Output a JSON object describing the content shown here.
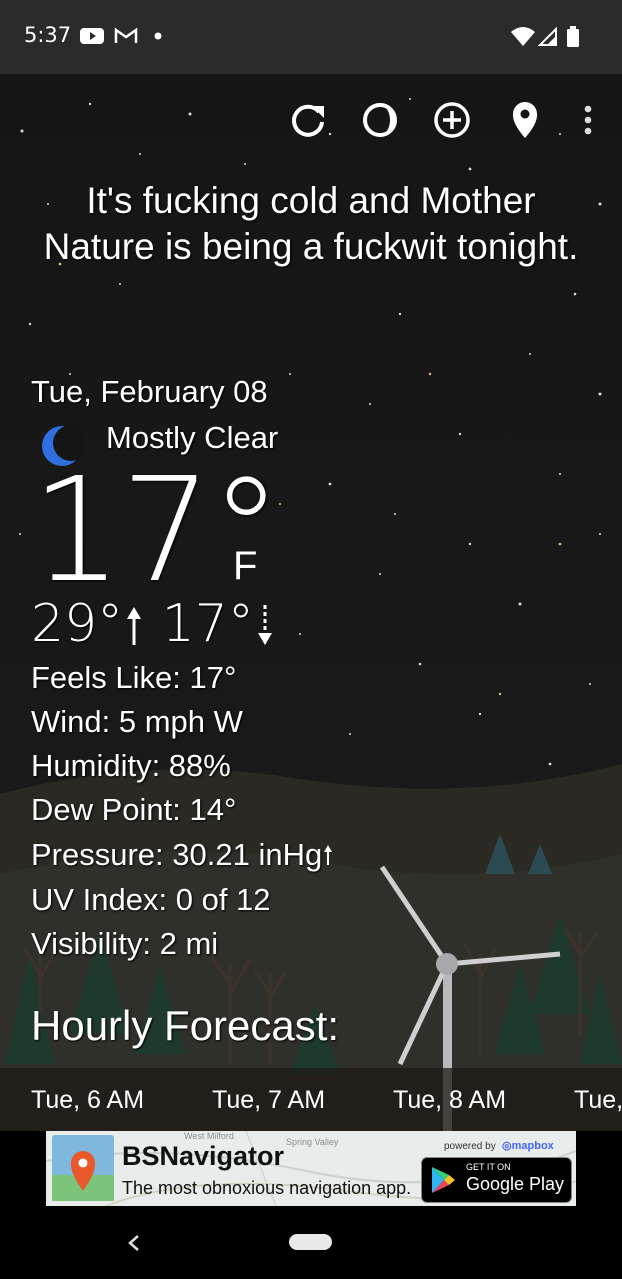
{
  "status_bar": {
    "time": "5:37"
  },
  "headline": "It's fucking cold and Mother Nature is being a fuckwit tonight.",
  "current": {
    "date": "Tue, February 08",
    "condition": "Mostly Clear",
    "temp": "17°",
    "unit": "F",
    "high": "29°",
    "low": "17°"
  },
  "details": {
    "feels_like": "Feels Like:  17°",
    "wind": "Wind:  5 mph W",
    "humidity": "Humidity:  88%",
    "dew_point": "Dew Point:  14°",
    "pressure": "Pressure:  30.21 inHg",
    "uv_index": "UV Index:  0 of 12",
    "visibility": "Visibility:  2 mi"
  },
  "hourly": {
    "title": "Hourly Forecast:",
    "hours": [
      "Tue, 6 AM",
      "Tue, 7 AM",
      "Tue, 8 AM",
      "Tue,"
    ]
  },
  "ad": {
    "title": "BSNavigator",
    "tagline": "The most obnoxious navigation app.",
    "powered": "powered by",
    "brand": "mapbox",
    "get_it_on": "GET IT ON",
    "store": "Google Play",
    "map_labels": [
      "West Milford",
      "Spring Valley"
    ]
  },
  "colors": {
    "moon": "#2f6fe0",
    "status_bar": "#2b2b2b"
  }
}
